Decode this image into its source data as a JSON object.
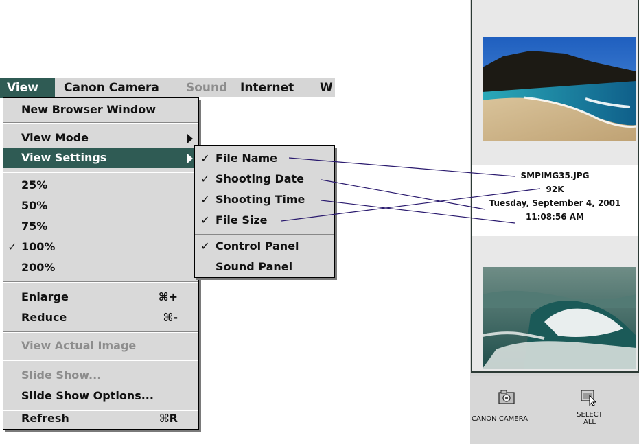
{
  "menubar": {
    "items": [
      {
        "label": "View",
        "state": "active"
      },
      {
        "label": "Canon Camera",
        "state": "normal"
      },
      {
        "label": "Sound",
        "state": "disabled"
      },
      {
        "label": "Internet",
        "state": "normal"
      },
      {
        "label": "W",
        "state": "normal"
      }
    ]
  },
  "view_menu": {
    "new_browser_window": "New Browser Window",
    "view_mode": "View Mode",
    "view_settings": "View Settings",
    "zoom": [
      "25%",
      "50%",
      "75%",
      "100%",
      "200%"
    ],
    "zoom_checked": "100%",
    "check_mark": "✓",
    "enlarge": "Enlarge",
    "enlarge_shortcut": "⌘+",
    "reduce": "Reduce",
    "reduce_shortcut": "⌘-",
    "view_actual_image": "View Actual Image",
    "slide_show": "Slide Show...",
    "slide_show_options": "Slide Show Options...",
    "refresh": "Refresh",
    "refresh_shortcut": "⌘R"
  },
  "settings_submenu": {
    "file_name": "File Name",
    "shooting_date": "Shooting Date",
    "shooting_time": "Shooting Time",
    "file_size": "File Size",
    "control_panel": "Control Panel",
    "sound_panel": "Sound Panel"
  },
  "image_info": {
    "file_name": "SMPIMG35.JPG",
    "file_size": "92K",
    "shooting_date": "Tuesday, September 4, 2001",
    "shooting_time": "11:08:56 AM"
  },
  "toolbar": {
    "canon_camera": "CANON CAMERA",
    "select_all_line1": "SELECT",
    "select_all_line2": "ALL"
  },
  "colors": {
    "highlight": "#2f5b54",
    "callout_line": "#2a1a6e"
  }
}
